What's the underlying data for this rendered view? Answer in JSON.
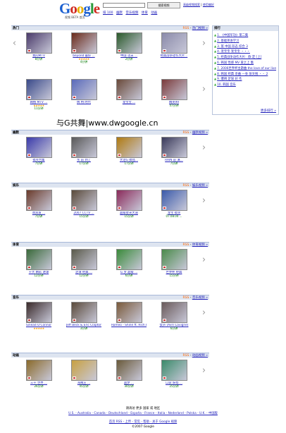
{
  "header": {
    "logo_text": "Google",
    "logo_sub": "视频 BETA 首页",
    "search_button": "搜索视频",
    "adv_search": "高级视频搜索",
    "help": "使用偏好"
  },
  "nav": [
    "排 100",
    "幽默",
    "音乐视频",
    "体育",
    "动画"
  ],
  "rank": {
    "title": "排行",
    "items": [
      "1. 《中国军功》第二集",
      "2. 基础英语学习",
      "3. 第 中国 形态 综合 3",
      "4. 宠宝宝 宠宝宝 ・・・",
      "5. 经典战争动作大片：欧 定 [上]",
      "6. 韩国 性感 MV 爱之上 集",
      "7. 2006世界杯主题曲 the love of our live",
      "8. 韩国 经典 金曲  一身 张文搜 ・・ 2",
      "9. 爆碑 足球 好 作",
      "10. 韩国 音乐"
    ],
    "more": "更多排行 »"
  },
  "watermark": "与G共舞|www.dwgoogle.cn",
  "sections": [
    {
      "title": "热门",
      "rss": "热门视频 »",
      "items": [
        {
          "cap": "我的MTV",
          "dur": "8分钟",
          "stars": "",
          "color": "#4a3a6a"
        },
        {
          "cap": "beyond 最好 ...",
          "dur": "4分钟",
          "stars": "★★★★★",
          "color": "#6a2a1a"
        },
        {
          "cap": "中国 功夫 ...",
          "dur": "2分钟",
          "stars": "",
          "color": "#2a5a2a"
        },
        {
          "cap": "经典战争动作大片...",
          "dur": "",
          "stars": "",
          "color": "#8a8aaa"
        },
        {
          "cap": "网络 MTV ...",
          "dur": "11分钟",
          "stars": "★★★★★",
          "color": "#3a4a8a"
        },
        {
          "cap": "情 特 时代",
          "dur": "",
          "stars": "",
          "color": "#5a6aba"
        },
        {
          "cap": "宠宝宝 ...",
          "dur": "",
          "stars": "",
          "color": "#6a4a3a"
        },
        {
          "cap": "精英99",
          "dur": "47分钟",
          "stars": "",
          "color": "#7a3a3a"
        }
      ]
    },
    {
      "title": "幽默",
      "rss": "幽默视频 »",
      "items": [
        {
          "cap": "搞笑合集",
          "dur": "7分钟",
          "stars": "",
          "color": "#3a3aaa"
        },
        {
          "cap": "亲 前 到了",
          "dur": "17分钟",
          "stars": "",
          "color": "#5a5a5a"
        },
        {
          "cap": "大话G 搞怪...",
          "dur": "17分钟",
          "stars": "",
          "color": "#b07a10"
        },
        {
          "cap": "RAIN 前 演...",
          "dur": "7分钟",
          "stars": "",
          "color": "#3a3a5a"
        }
      ]
    },
    {
      "title": "娱乐",
      "rss": "娱乐视频 »",
      "items": [
        {
          "cap": "周润发 ...",
          "dur": "7分钟",
          "stars": "",
          "color": "#6a3a2a"
        },
        {
          "cap": "2007 CCTV ...",
          "dur": "15分钟",
          "stars": "",
          "color": "#5a4a3a"
        },
        {
          "cap": "超级星光大道",
          "dur": "15分钟",
          "stars": "",
          "color": "#8a2a5a"
        },
        {
          "cap": "宠宝 搞笑",
          "dur": "07.08.04 ...",
          "stars": "",
          "color": "#3a5aaa"
        }
      ]
    },
    {
      "title": "体育",
      "rss": "体育视频 »",
      "items": [
        {
          "cap": "十大 精彩 进球",
          "dur": "12分钟",
          "stars": "",
          "color": "#3a6a3a"
        },
        {
          "cap": "足球 经典 ...",
          "dur": "12分钟",
          "stars": "",
          "color": "#5a5a4a"
        },
        {
          "cap": "G 罗 超级 ...",
          "dur": "6分钟",
          "stars": "",
          "color": "#3a8a3a"
        },
        {
          "cap": "世界杯 经典",
          "dur": "15分钟",
          "stars": "",
          "color": "#4a8a4a"
        }
      ]
    },
    {
      "title": "音乐",
      "rss": "音乐视频 »",
      "items": [
        {
          "cap": "Sinead O'Connor",
          "dur": "",
          "stars": "★★★★★",
          "color": "#3a2a2a"
        },
        {
          "cap": "Jeff Beck & Eric Clapton",
          "dur": "3分钟",
          "stars": "",
          "color": "#5a4a3a"
        },
        {
          "cap": "Romeo - Shine ft. Rich Boy",
          "dur": "",
          "stars": "",
          "color": "#7a5a3a"
        },
        {
          "cap": "女声 (Avril Lavigne)",
          "dur": "6分钟",
          "stars": "",
          "color": "#6a5a5a"
        }
      ]
    },
    {
      "title": "动画",
      "rss": "动画视频 »",
      "items": [
        {
          "cap": "三千 世界 ...",
          "dur": "26分钟",
          "stars": "",
          "color": "#8a6a2a"
        },
        {
          "cap": "海贼王 ...",
          "dur": "45分钟",
          "stars": "",
          "color": "#c8a040"
        },
        {
          "cap": "超梦 ...",
          "dur": "30分钟",
          "stars": "",
          "color": "#6a5a3a"
        },
        {
          "cap": "口袋 妖怪 ...",
          "dur": "25分钟",
          "stars": "",
          "color": "#3a8a6a"
        }
      ]
    }
  ],
  "footer": {
    "line1": "请再访 更多 国家 或 地区 ",
    "countries": "U.S. - Australia - Canada - Deutschland - España - France - Italia - Nederland - Polska - U.K. - 中国版",
    "links": "首页 RSS - 上传 - 常见 - 帮助 - 关于 Google 视频",
    "copy": "©2007 Google"
  }
}
